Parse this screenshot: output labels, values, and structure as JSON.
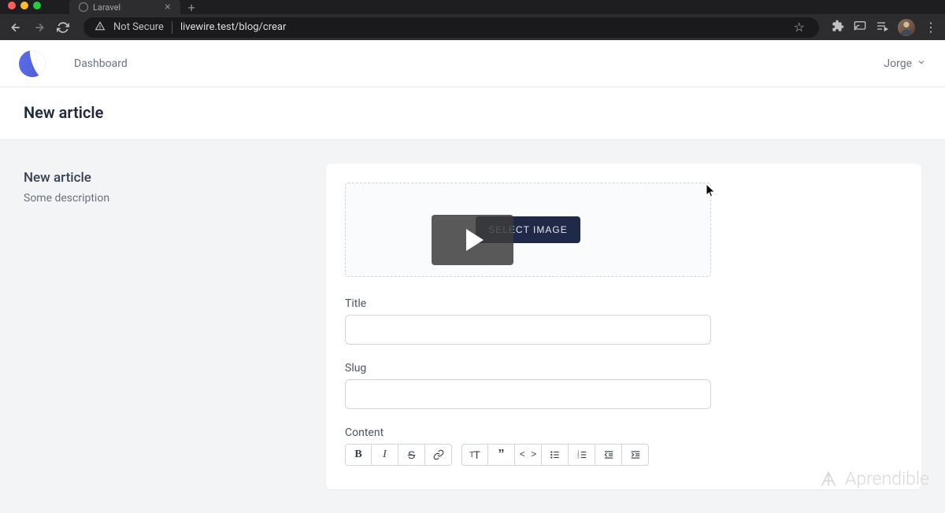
{
  "browser": {
    "tab_title": "Laravel",
    "not_secure_label": "Not Secure",
    "url": "livewire.test/blog/crear"
  },
  "nav": {
    "dashboard_label": "Dashboard",
    "user_name": "Jorge"
  },
  "page": {
    "title": "New article",
    "section_title": "New article",
    "section_description": "Some description"
  },
  "form": {
    "select_image_label": "SELECT IMAGE",
    "title_label": "Title",
    "title_value": "",
    "slug_label": "Slug",
    "slug_value": "",
    "content_label": "Content"
  },
  "watermark": {
    "text": "Aprendible"
  }
}
